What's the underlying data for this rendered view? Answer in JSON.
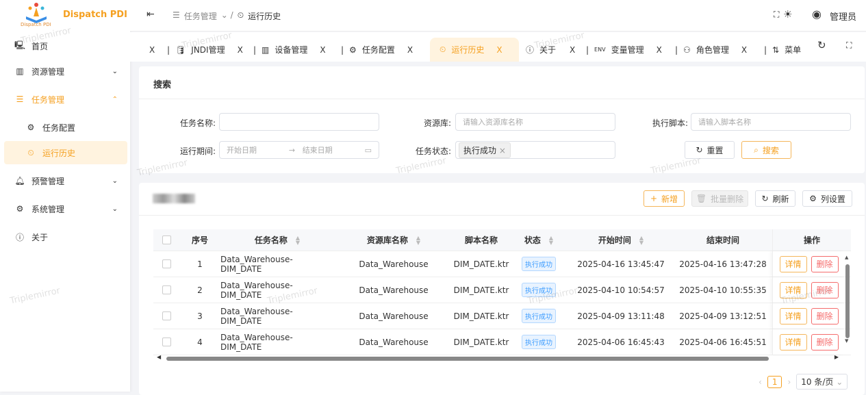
{
  "brand": {
    "name": "Dispatch PDI",
    "logo_text": "Dispatch PDI"
  },
  "sidebar": {
    "items": [
      {
        "label": "首页",
        "icon": "monitor-icon"
      },
      {
        "label": "资源管理",
        "icon": "columns-icon"
      },
      {
        "label": "任务管理",
        "icon": "checklist-icon"
      },
      {
        "label": "任务配置",
        "icon": "gear-icon"
      },
      {
        "label": "运行历史",
        "icon": "history-icon"
      },
      {
        "label": "预警管理",
        "icon": "bell-icon"
      },
      {
        "label": "系统管理",
        "icon": "settings-screen-icon"
      },
      {
        "label": "关于",
        "icon": "info-icon"
      }
    ]
  },
  "header": {
    "breadcrumb": [
      "任务管理",
      "运行历史"
    ],
    "user": "管理员"
  },
  "tabs": [
    {
      "label": "JNDI管理"
    },
    {
      "label": "设备管理"
    },
    {
      "label": "任务配置"
    },
    {
      "label": "运行历史"
    },
    {
      "label": "关于"
    },
    {
      "label": "变量管理"
    },
    {
      "label": "角色管理"
    },
    {
      "label": "菜单"
    }
  ],
  "tab_close": "X",
  "search": {
    "title": "搜索",
    "task_name_label": "任务名称:",
    "task_name_value": "",
    "repo_label": "资源库:",
    "repo_placeholder": "请输入资源库名称",
    "script_label": "执行脚本:",
    "script_placeholder": "请输入脚本名称",
    "period_label": "运行期间:",
    "start_placeholder": "开始日期",
    "end_placeholder": "结束日期",
    "status_label": "任务状态:",
    "status_value": "执行成功",
    "reset": "重置",
    "search": "搜索"
  },
  "toolbar": {
    "add": "新增",
    "batch_delete": "批量删除",
    "refresh": "刷新",
    "columns": "列设置"
  },
  "table": {
    "columns": [
      "序号",
      "任务名称",
      "资源库名称",
      "脚本名称",
      "状态",
      "开始时间",
      "结束时间",
      "操作"
    ],
    "rows": [
      {
        "no": "1",
        "task": "Data_Warehouse-DIM_DATE",
        "repo": "Data_Warehouse",
        "script": "DIM_DATE.ktr",
        "status": "执行成功",
        "start": "2025-04-16 13:45:47",
        "end": "2025-04-16 13:47:28"
      },
      {
        "no": "2",
        "task": "Data_Warehouse-DIM_DATE",
        "repo": "Data_Warehouse",
        "script": "DIM_DATE.ktr",
        "status": "执行成功",
        "start": "2025-04-10 10:54:57",
        "end": "2025-04-10 10:55:35"
      },
      {
        "no": "3",
        "task": "Data_Warehouse-DIM_DATE",
        "repo": "Data_Warehouse",
        "script": "DIM_DATE.ktr",
        "status": "执行成功",
        "start": "2025-04-09 13:11:48",
        "end": "2025-04-09 13:12:51"
      },
      {
        "no": "4",
        "task": "Data_Warehouse-DIM_DATE",
        "repo": "Data_Warehouse",
        "script": "DIM_DATE.ktr",
        "status": "执行成功",
        "start": "2025-04-06 16:45:43",
        "end": "2025-04-06 16:45:51"
      }
    ],
    "detail": "详情",
    "delete": "删除"
  },
  "pagination": {
    "page": "1",
    "page_size": "10 条/页"
  },
  "watermark": "Triplemirror",
  "colors": {
    "accent": "#f5a020",
    "danger": "#f56c6c",
    "tag": "#409eff"
  }
}
